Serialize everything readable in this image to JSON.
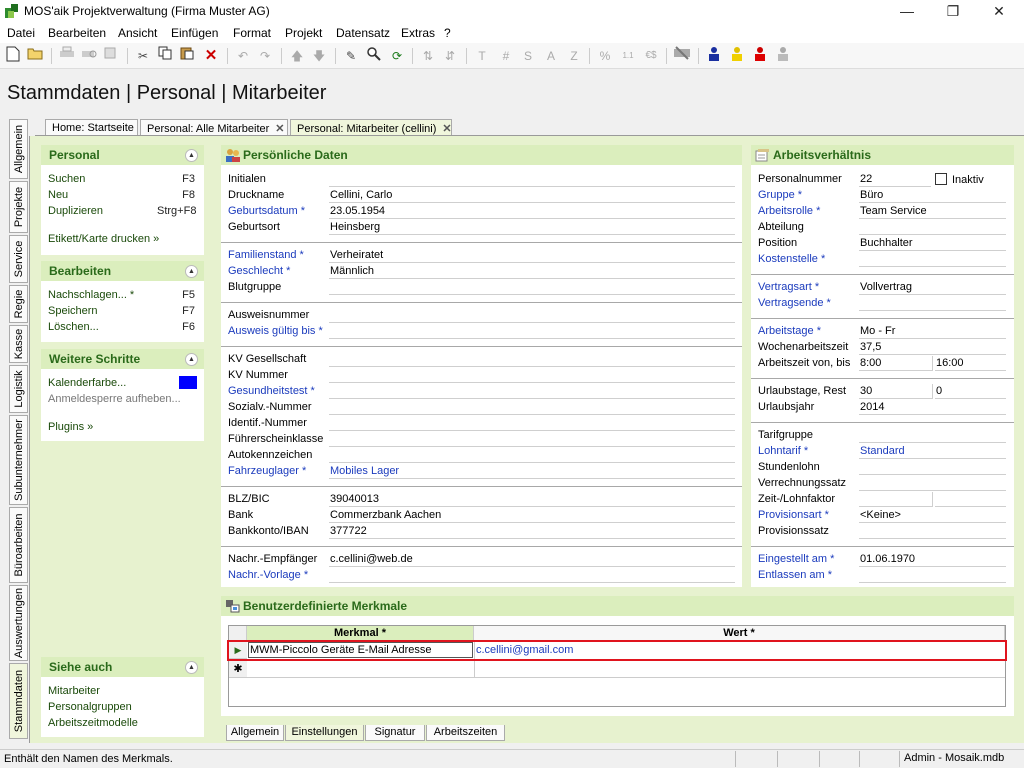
{
  "window": {
    "title": "MOS'aik Projektverwaltung (Firma Muster AG)",
    "minimize": "—",
    "maximize": "❐",
    "close": "✕"
  },
  "menu": [
    "Datei",
    "Bearbeiten",
    "Ansicht",
    "Einfügen",
    "Format",
    "Projekt",
    "Datensatz",
    "Extras",
    "?"
  ],
  "toolbar_text": {
    "t": "T",
    "hash": "#",
    "s": "S",
    "a": "A",
    "z": "Z",
    "percent": "%",
    "num": "1.1",
    "currency": "€$"
  },
  "page_title": "Stammdaten | Personal | Mitarbeiter",
  "doc_tabs": [
    {
      "label": "Home: Startseite"
    },
    {
      "label": "Personal: Alle Mitarbeiter",
      "close": "✕"
    },
    {
      "label": "Personal: Mitarbeiter (cellini)",
      "close": "✕"
    }
  ],
  "vertical_tabs": [
    "Allgemein",
    "Projekte",
    "Service",
    "Regie",
    "Kasse",
    "Logistik",
    "Subunternehmer",
    "Büroarbeiten",
    "Auswertungen",
    "Stammdaten"
  ],
  "left_panel": {
    "personal": {
      "title": "Personal",
      "items": [
        {
          "label": "Suchen",
          "key": "F3"
        },
        {
          "label": "Neu",
          "key": "F8"
        },
        {
          "label": "Duplizieren",
          "key": "Strg+F8"
        }
      ],
      "extra": "Etikett/Karte drucken »"
    },
    "bearbeiten": {
      "title": "Bearbeiten",
      "items": [
        {
          "label": "Nachschlagen... *",
          "key": "F5"
        },
        {
          "label": "Speichern",
          "key": "F7"
        },
        {
          "label": "Löschen...",
          "key": "F6"
        }
      ]
    },
    "weitere": {
      "title": "Weitere Schritte",
      "items": [
        "Kalenderfarbe...",
        "Anmeldesperre aufheben...",
        "Plugins »"
      ],
      "calendar_color": "#0000ff"
    },
    "siehe": {
      "title": "Siehe auch",
      "items": [
        "Mitarbeiter",
        "Personalgruppen",
        "Arbeitszeitmodelle"
      ]
    }
  },
  "personal_data": {
    "title": "Persönliche Daten",
    "rows": [
      {
        "label": "Initialen",
        "value": ""
      },
      {
        "label": "Druckname",
        "value": "Cellini, Carlo"
      },
      {
        "label": "Geburtsdatum *",
        "value": "23.05.1954",
        "link": true
      },
      {
        "label": "Geburtsort",
        "value": "Heinsberg"
      },
      {
        "label": "Familienstand *",
        "value": "Verheiratet",
        "link": true
      },
      {
        "label": "Geschlecht *",
        "value": "Männlich",
        "link": true
      },
      {
        "label": "Blutgruppe",
        "value": ""
      },
      {
        "label": "Ausweisnummer",
        "value": ""
      },
      {
        "label": "Ausweis gültig bis *",
        "value": "",
        "link": true
      },
      {
        "label": "KV Gesellschaft",
        "value": ""
      },
      {
        "label": "KV Nummer",
        "value": ""
      },
      {
        "label": "Gesundheitstest *",
        "value": "",
        "link": true
      },
      {
        "label": "Sozialv.-Nummer",
        "value": ""
      },
      {
        "label": "Identif.-Nummer",
        "value": ""
      },
      {
        "label": "Führerscheinklasse",
        "value": ""
      },
      {
        "label": "Autokennzeichen",
        "value": ""
      },
      {
        "label": "Fahrzeuglager *",
        "value": "Mobiles Lager",
        "link": true,
        "value_link": true
      },
      {
        "label": "BLZ/BIC",
        "value": "39040013"
      },
      {
        "label": "Bank",
        "value": "Commerzbank Aachen"
      },
      {
        "label": "Bankkonto/IBAN",
        "value": "377722"
      },
      {
        "label": "Nachr.-Empfänger",
        "value": "c.cellini@web.de"
      },
      {
        "label": "Nachr.-Vorlage *",
        "value": "",
        "link": true
      }
    ]
  },
  "employment": {
    "title": "Arbeitsverhältnis",
    "inaktiv_label": "Inaktiv",
    "rows": [
      {
        "label": "Personalnummer",
        "value": "22"
      },
      {
        "label": "Gruppe *",
        "value": "Büro",
        "link": true
      },
      {
        "label": "Arbeitsrolle *",
        "value": "Team Service",
        "link": true
      },
      {
        "label": "Abteilung",
        "value": ""
      },
      {
        "label": "Position",
        "value": "Buchhalter"
      },
      {
        "label": "Kostenstelle *",
        "value": "",
        "link": true
      },
      {
        "label": "Vertragsart *",
        "value": "Vollvertrag",
        "link": true
      },
      {
        "label": "Vertragsende *",
        "value": "",
        "link": true
      },
      {
        "label": "Arbeitstage *",
        "value": "Mo - Fr",
        "link": true
      },
      {
        "label": "Wochenarbeitszeit",
        "value": "37,5"
      },
      {
        "label": "Arbeitszeit von, bis",
        "value": "8:00",
        "value2": "16:00"
      },
      {
        "label": "Urlaubstage, Rest",
        "value": "30",
        "value2": "0"
      },
      {
        "label": "Urlaubsjahr",
        "value": "2014"
      },
      {
        "label": "Tarifgruppe",
        "value": ""
      },
      {
        "label": "Lohntarif *",
        "value": "Standard",
        "link": true,
        "value_link": true
      },
      {
        "label": "Stundenlohn",
        "value": ""
      },
      {
        "label": "Verrechnungssatz",
        "value": ""
      },
      {
        "label": "Zeit-/Lohnfaktor",
        "value": "",
        "value2": ""
      },
      {
        "label": "Provisionsart *",
        "value": "<Keine>",
        "link": true
      },
      {
        "label": "Provisionssatz",
        "value": ""
      },
      {
        "label": "Eingestellt am *",
        "value": "01.06.1970",
        "link": true
      },
      {
        "label": "Entlassen am *",
        "value": "",
        "link": true
      }
    ]
  },
  "custom_features": {
    "title": "Benutzerdefinierte Merkmale",
    "col_merkmal": "Merkmal *",
    "col_wert": "Wert *",
    "rows": [
      {
        "merkmal": "MWM-Piccolo Geräte E-Mail Adresse",
        "wert": "c.cellini@gmail.com"
      }
    ],
    "new_row_marker": "✱",
    "current_row_marker": "▶"
  },
  "bottom_tabs": [
    "Allgemein",
    "Einstellungen",
    "Signatur",
    "Arbeitszeiten"
  ],
  "status": {
    "text": "Enthält den Namen des Merkmals.",
    "db": "Admin - Mosaik.mdb"
  }
}
